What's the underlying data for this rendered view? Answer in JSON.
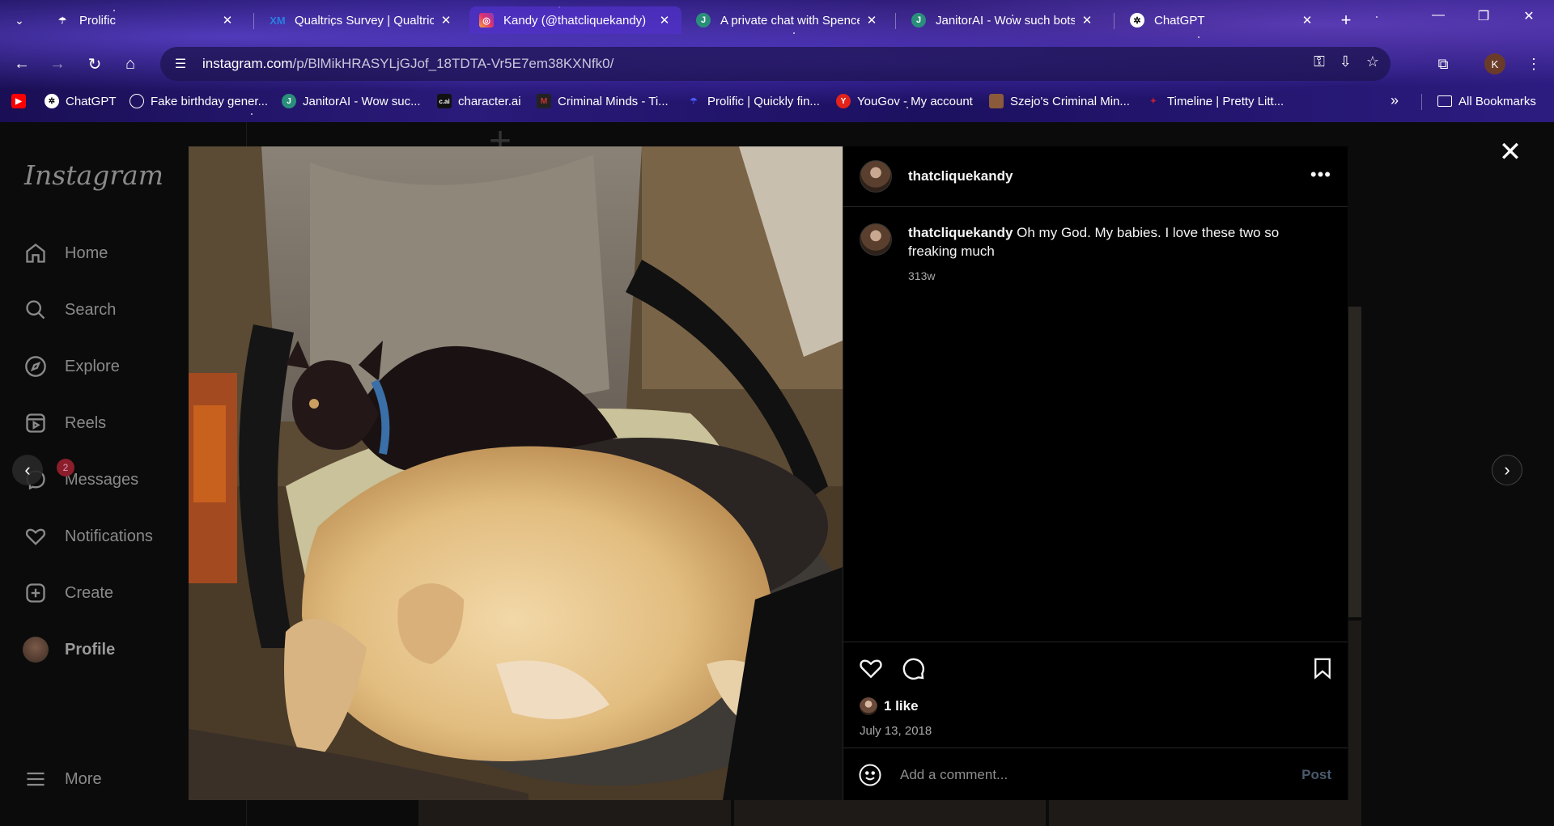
{
  "browser": {
    "tabs": [
      {
        "title": "Prolific",
        "favicon": "P",
        "favicon_color": "#ffffff",
        "active": false
      },
      {
        "title": "Qualtrics Survey | Qualtrics",
        "favicon": "XM",
        "favicon_color": "#2a7de1",
        "active": false
      },
      {
        "title": "Kandy (@thatcliquekandy)",
        "favicon": "IG",
        "favicon_color": "#e1306c",
        "active": true
      },
      {
        "title": "A private chat with Spencer",
        "favicon": "J",
        "favicon_color": "#2a8f7a",
        "active": false
      },
      {
        "title": "JanitorAI - Wow such bots",
        "favicon": "J",
        "favicon_color": "#2a8f7a",
        "active": false
      },
      {
        "title": "ChatGPT",
        "favicon": "G",
        "favicon_color": "#ffffff",
        "active": false
      }
    ],
    "url_host": "instagram.com",
    "url_path": "/p/BlMikHRASYLjGJof_18TDTA-Vr5E7em38KXNfk0/",
    "profile_initial": "K",
    "bookmarks": [
      {
        "label": "",
        "icon": "youtube-icon",
        "color": "#ff0000"
      },
      {
        "label": "ChatGPT",
        "icon": "chatgpt-icon",
        "color": "#ffffff"
      },
      {
        "label": "Fake birthday gener...",
        "icon": "globe-icon",
        "color": "#ffffff"
      },
      {
        "label": "JanitorAI - Wow suc...",
        "icon": "janitorai-icon",
        "color": "#2a8f7a"
      },
      {
        "label": "character.ai",
        "icon": "characterai-icon",
        "color": "#000000"
      },
      {
        "label": "Criminal Minds - Ti...",
        "icon": "fandom-icon",
        "color": "#8b1e1e"
      },
      {
        "label": "Prolific | Quickly fin...",
        "icon": "prolific-icon",
        "color": "#4a5cff"
      },
      {
        "label": "YouGov - My account",
        "icon": "yougov-icon",
        "color": "#e2231a"
      },
      {
        "label": "Szejo's Criminal Min...",
        "icon": "ao3-icon",
        "color": "#8a5a3a"
      },
      {
        "label": "Timeline | Pretty Litt...",
        "icon": "pll-icon",
        "color": "#c02030"
      }
    ],
    "all_bookmarks_label": "All Bookmarks"
  },
  "sidebar": {
    "logo": "Instagram",
    "items": [
      {
        "label": "Home",
        "icon": "home-icon"
      },
      {
        "label": "Search",
        "icon": "search-icon"
      },
      {
        "label": "Explore",
        "icon": "compass-icon"
      },
      {
        "label": "Reels",
        "icon": "reels-icon"
      },
      {
        "label": "Messages",
        "icon": "messenger-icon"
      },
      {
        "label": "Notifications",
        "icon": "heart-icon"
      },
      {
        "label": "Create",
        "icon": "plus-square-icon"
      },
      {
        "label": "Profile",
        "icon": "avatar"
      }
    ],
    "messages_badge": "2",
    "more_label": "More"
  },
  "post": {
    "username": "thatcliquekandy",
    "caption": "Oh my God. My babies. I love these two so freaking much",
    "caption_age": "313w",
    "likes": "1 like",
    "date": "July 13, 2018",
    "comment_placeholder": "Add a comment...",
    "post_button": "Post"
  }
}
